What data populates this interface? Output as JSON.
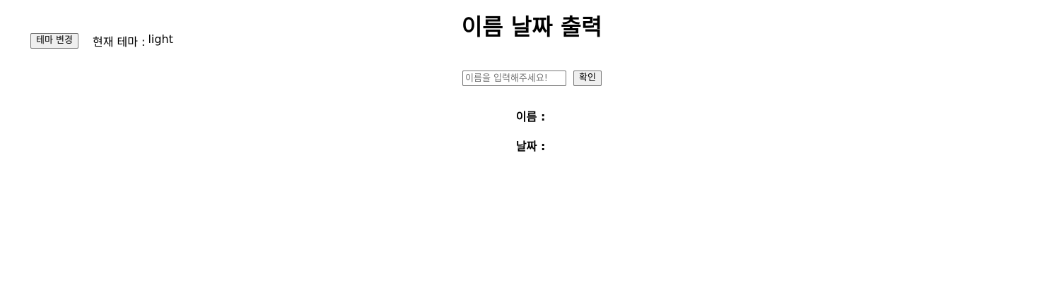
{
  "header": {
    "title": "이름 날짜 출력"
  },
  "theme": {
    "button_label": "테마 변경",
    "current_label": "현재 테마 :",
    "current_value": "light"
  },
  "form": {
    "name_placeholder": "이름을 입력해주세요!",
    "name_value": "",
    "confirm_label": "확인"
  },
  "results": {
    "name_label": "이름 :",
    "name_value": "",
    "date_label": "날짜 :",
    "date_value": ""
  }
}
